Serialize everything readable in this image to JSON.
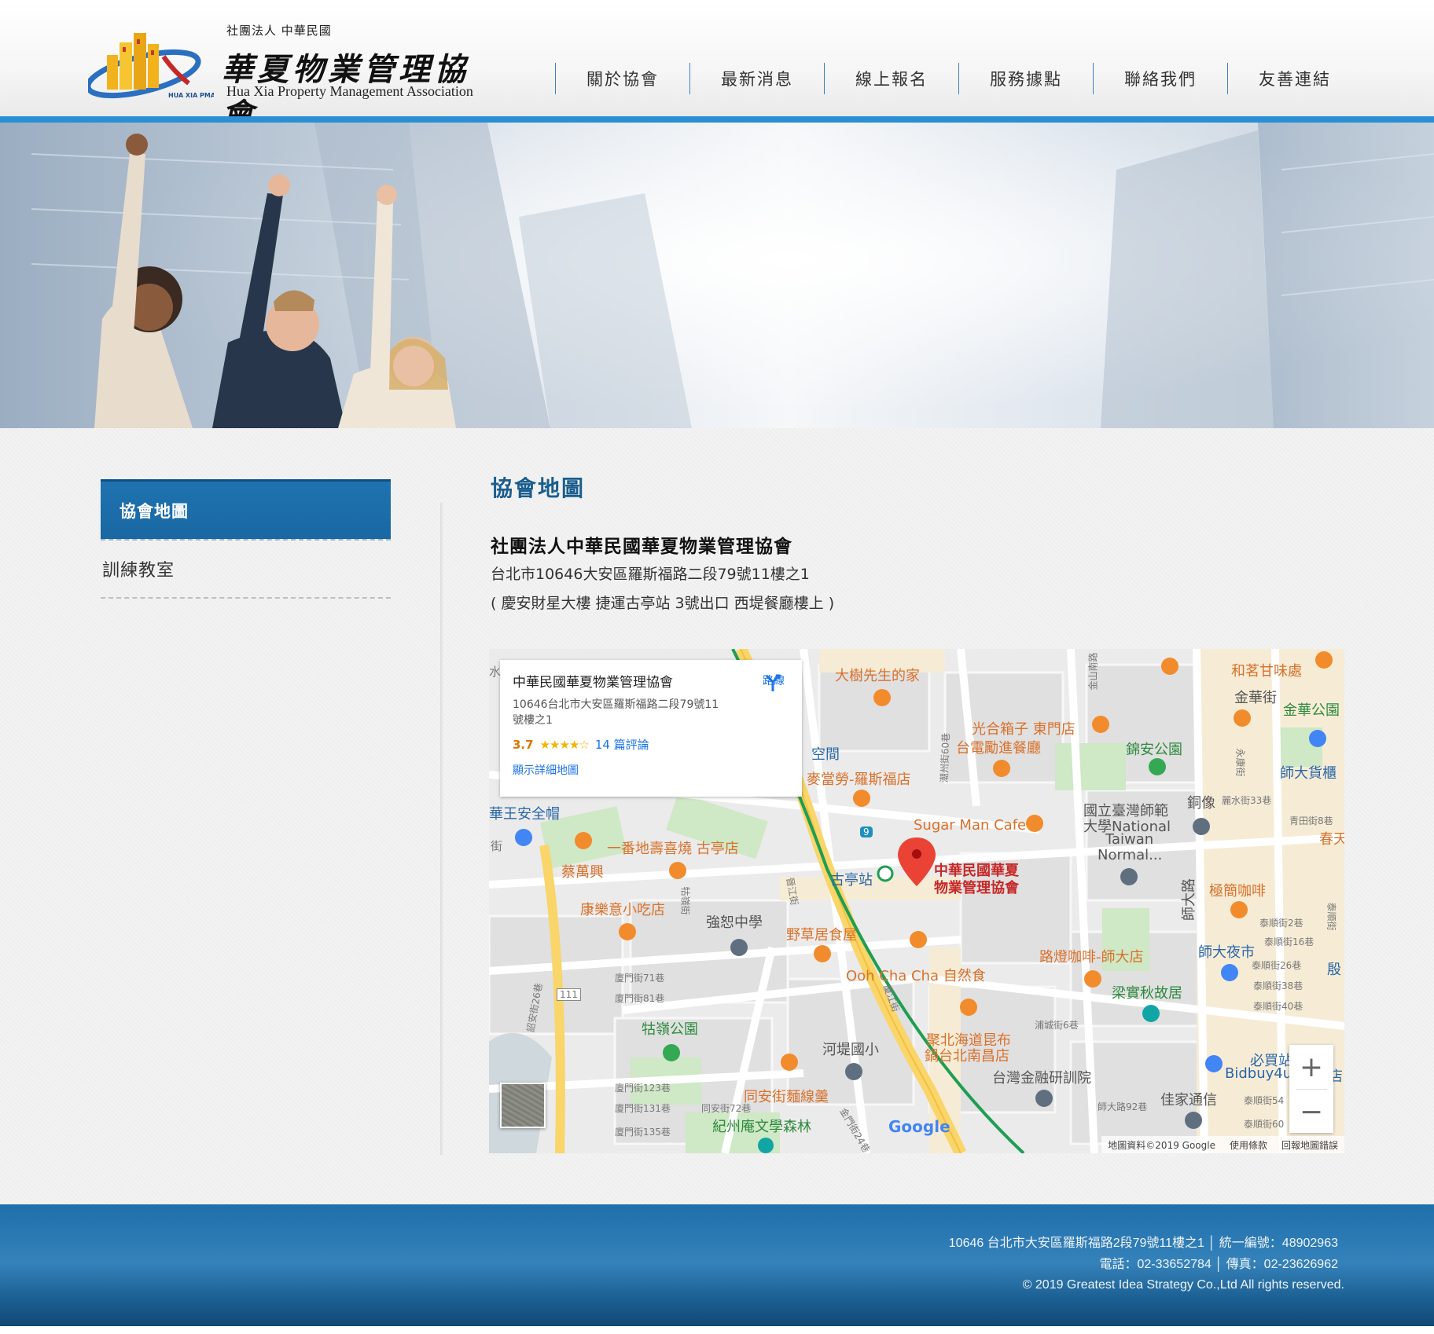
{
  "header": {
    "logo_sub": "社團法人 中華民國",
    "logo_title": "華夏物業管理協會",
    "logo_en": "Hua Xia Property Management Association",
    "logo_mark_text": "HUA XIA PMA",
    "colors": {
      "accent": "#2a8fd4",
      "nav_divider": "#3f7fc0"
    }
  },
  "nav": [
    {
      "label": "關於協會"
    },
    {
      "label": "最新消息"
    },
    {
      "label": "線上報名"
    },
    {
      "label": "服務據點"
    },
    {
      "label": "聯絡我們"
    },
    {
      "label": "友善連結"
    }
  ],
  "sidebar": {
    "active_label": "協會地圖",
    "item_label": "訓練教室",
    "active_color": "#1f73b0"
  },
  "main": {
    "title": "協會地圖",
    "org_name": "社團法人中華民國華夏物業管理協會",
    "address": "台北市10646大安區羅斯福路二段79號11樓之1",
    "note": "( 慶安財星大樓 捷運古亭站 3號出口 西堤餐廳樓上 )"
  },
  "map": {
    "card": {
      "title": "中華民國華夏物業管理協會",
      "address": "10646台北市大安區羅斯福路二段79號11號樓之1",
      "rating": "3.7",
      "stars": "★★★★☆",
      "reviews": "14 篇評論",
      "detail_link": "顯示詳細地圖",
      "directions_label": "路線"
    },
    "marker_label_1": "中華民國華夏",
    "marker_label_2": "物業管理協會",
    "pois": {
      "p1": "大樹先生的家",
      "p2": "光合箱子 東門店",
      "p3": "台電勵進餐廳",
      "p4": "錦安公園",
      "p5": "金華公園",
      "p6": "和茗甘味處",
      "p7": "金華街",
      "p8": "師大貨櫃",
      "p9": "麥當勞-羅斯福店",
      "p10": "Sugar Man Cafe",
      "p11": "國立臺灣師範",
      "p12": "大學National",
      "p13": "Taiwan",
      "p14": "Normal...",
      "p15": "銅像",
      "p16": "一番地壽喜燒 古亭店",
      "p17": "蔡萬興",
      "p18": "華王安全帽",
      "p19": "古亭站",
      "p20": "極簡咖啡",
      "p21": "康樂意小吃店",
      "p22": "強恕中學",
      "p23": "野草居食屋",
      "p24": "Ooh Cha Cha 自然食",
      "p25": "路燈咖啡-師大店",
      "p26": "師大夜市",
      "p27": "梁實秋故居",
      "p28": "牯嶺公園",
      "p29": "河堤國小",
      "p30": "聚北海道昆布",
      "p31": "鍋台北南昌店",
      "p32": "台灣金融研訓院",
      "p33": "必買站",
      "p34": "Bidbuy4u",
      "p35": "佳家通信",
      "p36": "同安街麵線羹",
      "p37": "紀州庵文學森林",
      "p38": "春天",
      "p39": "殷",
      "p40": "店",
      "p41": "空間",
      "p42": "師大路"
    },
    "streets": {
      "s1": "廈門街71巷",
      "s2": "廈門街81巷",
      "s3": "廈門街123巷",
      "s4": "廈門街131巷",
      "s5": "廈門街135巷",
      "s6": "同安街72巷",
      "s7": "泰順街2巷",
      "s8": "泰順街16巷",
      "s9": "泰順街26巷",
      "s10": "泰順街38巷",
      "s11": "泰順街40巷",
      "s12": "浦城街6巷",
      "s13": "師大路92巷",
      "s14": "麗水街33巷",
      "s15": "青田街8巷",
      "s16": "牯嶺街",
      "s17": "詔安街26巷",
      "s18": "潮州街60巷",
      "s19": "金山南路",
      "s20": "永康街",
      "s21": "泰順街",
      "s22": "泰順街60",
      "s23": "泰順街54",
      "s24": "金門街24巷",
      "s25": "廈江街",
      "s26": "晉江街",
      "s27": "水",
      "s28": "街",
      "s29": "111",
      "s30": "9"
    },
    "google": "Google",
    "footer_data": "地圖資料©2019 Google",
    "footer_terms": "使用條款",
    "footer_report": "回報地圖錯誤",
    "zoom_in": "+",
    "zoom_out": "−"
  },
  "footer": {
    "line1": "10646 台北市大安區羅斯福路2段79號11樓之1 │ 統一編號：48902963",
    "line2": "電話：02-33652784 │ 傳真：02-23626962",
    "line3": "© 2019 Greatest Idea Strategy Co.,Ltd All rights reserved."
  }
}
